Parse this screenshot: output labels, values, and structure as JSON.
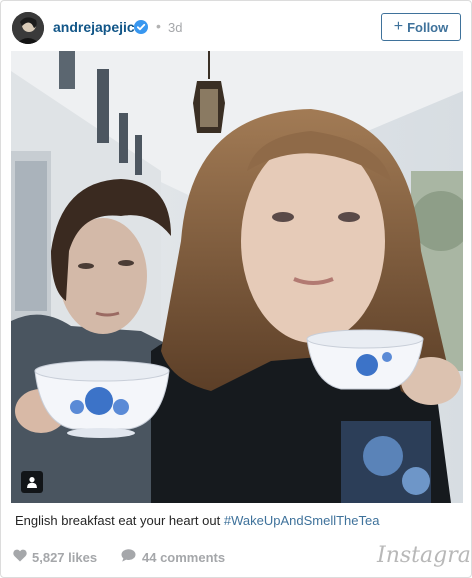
{
  "header": {
    "username": "andrejapejic",
    "separator": "•",
    "time": "3d",
    "follow_plus": "+",
    "follow_label": "Follow"
  },
  "post": {
    "caption_text": "English breakfast eat your heart out ",
    "hashtag": "#WakeUpAndSmellTheTea",
    "photo_alt": "Two people holding blue-and-white porcelain teacups on a porch"
  },
  "footer": {
    "likes": "5,827 likes",
    "comments": "44 comments",
    "logo": "Instagram"
  },
  "colors": {
    "username": "#125688",
    "follow_border": "#3f729b",
    "hashtag": "#3f729b",
    "muted": "#a5a7aa",
    "verified": "#3897f0"
  },
  "icons": [
    "avatar",
    "verified-badge-icon",
    "plus-icon",
    "user-tag-icon",
    "heart-icon",
    "comment-bubble-icon",
    "instagram-logo"
  ]
}
